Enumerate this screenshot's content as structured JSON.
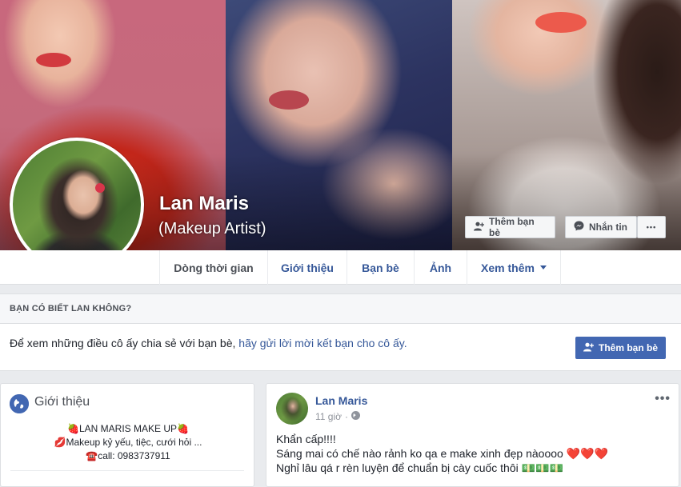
{
  "profile": {
    "name": "Lan Maris",
    "subtitle": "(Makeup Artist)"
  },
  "cover_actions": {
    "add_friend": "Thêm bạn bè",
    "message": "Nhắn tin",
    "more": "•••"
  },
  "nav": {
    "tabs": [
      {
        "label": "Dòng thời gian",
        "active": true
      },
      {
        "label": "Giới thiệu"
      },
      {
        "label": "Bạn bè"
      },
      {
        "label": "Ảnh"
      },
      {
        "label": "Xem thêm"
      }
    ]
  },
  "know_card": {
    "heading": "BẠN CÓ BIẾT LAN KHÔNG?",
    "text": "Để xem những điều cô ấy chia sẻ với bạn bè, ",
    "link": "hãy gửi lời mời kết bạn cho cô ấy.",
    "button": "Thêm bạn bè"
  },
  "intro": {
    "title": "Giới thiệu",
    "bio": [
      "🍓LAN MARIS MAKE UP🍓",
      "💋Makeup kỷ yếu, tiệc, cưới hỏi ...",
      "☎️call: 0983737911"
    ]
  },
  "post": {
    "author": "Lan Maris",
    "time": "11 giờ",
    "lines": [
      "Khẩn cấp!!!!",
      "Sáng mai có chế nào rảnh ko qa e make xinh đẹp nàoooo ❤️❤️❤️",
      "Nghỉ lâu qá r rèn luyện để chuẩn bị cày cuốc thôi 💵💵💵"
    ],
    "more": "•••"
  },
  "colors": {
    "link_blue": "#365899",
    "primary_button": "#4267b2",
    "page_bg": "#e9ebee"
  },
  "icons": [
    "add-friend-icon",
    "messenger-icon",
    "globe-icon",
    "public-icon",
    "chevron-down-icon"
  ]
}
